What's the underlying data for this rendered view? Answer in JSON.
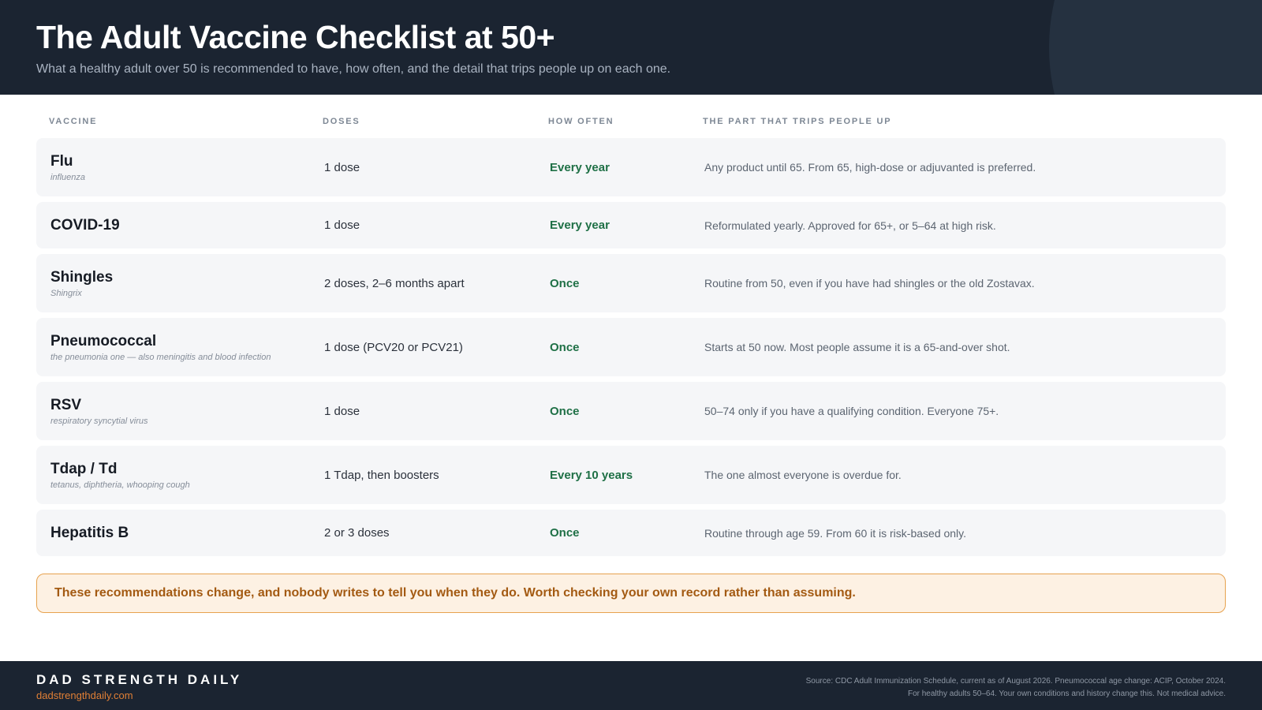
{
  "header": {
    "title": "The Adult Vaccine Checklist at 50+",
    "subtitle": "What a healthy adult over 50 is recommended to have, how often, and the detail that trips people up on each one."
  },
  "columns": {
    "vaccine": "VACCINE",
    "doses": "DOSES",
    "frequency": "HOW OFTEN",
    "note": "THE PART THAT TRIPS PEOPLE UP"
  },
  "vaccines": [
    {
      "name": "Flu",
      "sub": "influenza",
      "doses": "1 dose",
      "frequency": "Every year",
      "note": "Any product until 65. From 65, high-dose or adjuvanted is preferred."
    },
    {
      "name": "COVID-19",
      "sub": "",
      "doses": "1 dose",
      "frequency": "Every year",
      "note": "Reformulated yearly. Approved for 65+, or 5–64 at high risk."
    },
    {
      "name": "Shingles",
      "sub": "Shingrix",
      "doses": "2 doses, 2–6 months apart",
      "frequency": "Once",
      "note": "Routine from 50, even if you have had shingles or the old Zostavax."
    },
    {
      "name": "Pneumococcal",
      "sub": "the pneumonia one — also meningitis and blood infection",
      "doses": "1 dose (PCV20 or PCV21)",
      "frequency": "Once",
      "note": "Starts at 50 now. Most people assume it is a 65-and-over shot."
    },
    {
      "name": "RSV",
      "sub": "respiratory syncytial virus",
      "doses": "1 dose",
      "frequency": "Once",
      "note": "50–74 only if you have a qualifying condition. Everyone 75+."
    },
    {
      "name": "Tdap / Td",
      "sub": "tetanus, diphtheria, whooping cough",
      "doses": "1 Tdap, then boosters",
      "frequency": "Every 10 years",
      "note": "The one almost everyone is overdue for."
    },
    {
      "name": "Hepatitis B",
      "sub": "",
      "doses": "2 or 3 doses",
      "frequency": "Once",
      "note": "Routine through age 59. From 60 it is risk-based only."
    }
  ],
  "callout": "These recommendations change, and nobody writes to tell you when they do. Worth checking your own record rather than assuming.",
  "footer": {
    "brand": "DAD STRENGTH DAILY",
    "url": "dadstrengthdaily.com",
    "source_line1": "Source: CDC Adult Immunization Schedule, current as of August 2026. Pneumococcal age change: ACIP, October 2024.",
    "source_line2": "For healthy adults 50–64. Your own conditions and history change this. Not medical advice."
  },
  "colors": {
    "header_bg": "#1b2431",
    "frequency_green": "#1f7046",
    "callout_text": "#a35a12",
    "callout_border": "#e7a24f",
    "brand_orange": "#e07f35"
  }
}
